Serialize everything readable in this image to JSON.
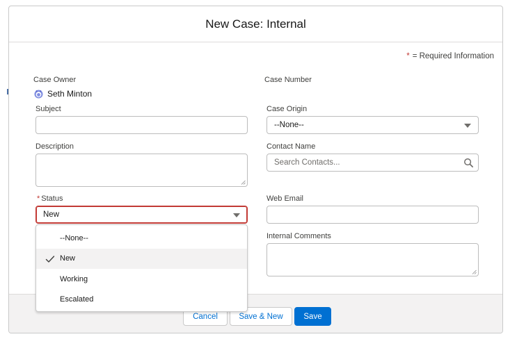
{
  "modal": {
    "title": "New Case: Internal",
    "required_star": "*",
    "required_text": "= Required Information"
  },
  "fields": {
    "case_owner": {
      "label": "Case Owner",
      "value": "Seth Minton"
    },
    "case_number": {
      "label": "Case Number"
    },
    "subject": {
      "label": "Subject",
      "value": ""
    },
    "case_origin": {
      "label": "Case Origin",
      "value": "--None--"
    },
    "description": {
      "label": "Description",
      "value": ""
    },
    "contact_name": {
      "label": "Contact Name",
      "placeholder": "Search Contacts..."
    },
    "status": {
      "required_star": "*",
      "label": "Status",
      "value": "New"
    },
    "web_email": {
      "label": "Web Email",
      "value": ""
    },
    "internal_comments": {
      "label": "Internal Comments",
      "value": ""
    }
  },
  "status_dropdown": {
    "options": [
      "--None--",
      "New",
      "Working",
      "Escalated"
    ],
    "selected": "New"
  },
  "footer": {
    "cancel_label": "Cancel",
    "save_new_label": "Save & New",
    "save_label": "Save"
  },
  "colors": {
    "brand": "#0070d2",
    "error": "#c23934"
  },
  "icons": {
    "owner": "user-avatar-icon",
    "search": "search-icon",
    "dropdown": "chevron-down-icon",
    "check": "check-icon"
  }
}
